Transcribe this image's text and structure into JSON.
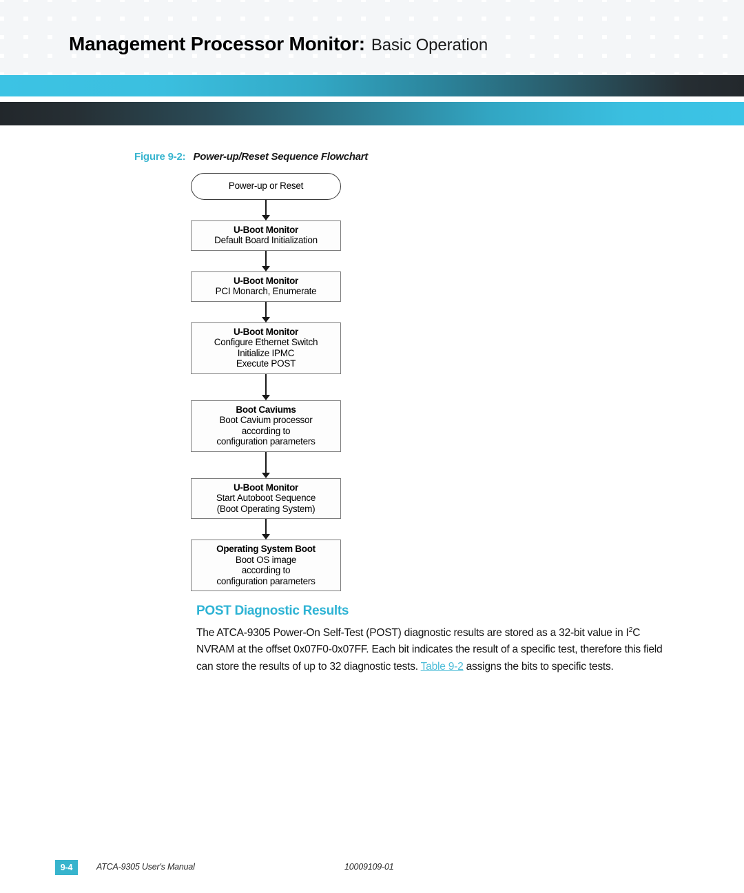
{
  "header": {
    "title_main": "Management Processor Monitor:",
    "title_sub": "Basic Operation",
    "bar_top_start_color": "#3cc3e4",
    "bar_top_end_color": "#23282c",
    "bar_bottom_start_color": "#22272b",
    "bar_bottom_end_color": "#3cc4e6"
  },
  "figure": {
    "label": "Figure 9-2:",
    "title": "Power-up/Reset Sequence Flowchart",
    "label_color": "#39b5cf",
    "nodes": [
      {
        "shape": "rounded",
        "title": "",
        "lines": [
          "Power-up or Reset"
        ]
      },
      {
        "shape": "rect",
        "title": "U-Boot Monitor",
        "lines": [
          "Default Board Initialization"
        ]
      },
      {
        "shape": "rect",
        "title": "U-Boot Monitor",
        "lines": [
          "PCI Monarch, Enumerate"
        ]
      },
      {
        "shape": "rect",
        "title": "U-Boot Monitor",
        "lines": [
          "Configure Ethernet Switch",
          "Initialize IPMC",
          "Execute POST"
        ]
      },
      {
        "shape": "rect",
        "title": "Boot Caviums",
        "lines": [
          "Boot Cavium processor",
          "according to",
          "configuration parameters"
        ]
      },
      {
        "shape": "rect",
        "title": "U-Boot Monitor",
        "lines": [
          "Start Autoboot Sequence",
          "(Boot Operating System)"
        ]
      },
      {
        "shape": "rect",
        "title": "Operating System Boot",
        "lines": [
          "Boot OS image",
          "according to",
          "configuration parameters"
        ]
      }
    ]
  },
  "section": {
    "heading": "POST Diagnostic Results",
    "heading_color": "#2eb3d4",
    "paragraph": {
      "part1": "The ATCA-9305 Power-On Self-Test (POST) diagnostic results are stored as a 32-bit value in I",
      "superscript": "2",
      "part2": "C NVRAM at the offset 0x07F0-0x07FF. Each bit indicates the result of a specific test, therefore this field can store the results of up to 32 diagnostic tests. ",
      "xref": "Table 9-2",
      "part3": " assigns the bits to specific tests."
    },
    "xref_color": "#4dbdd8"
  },
  "footer": {
    "page_number": "9-4",
    "page_box_color": "#37b4cd",
    "manual_name": "ATCA-9305 User's Manual",
    "part_number": "10009109-01"
  }
}
